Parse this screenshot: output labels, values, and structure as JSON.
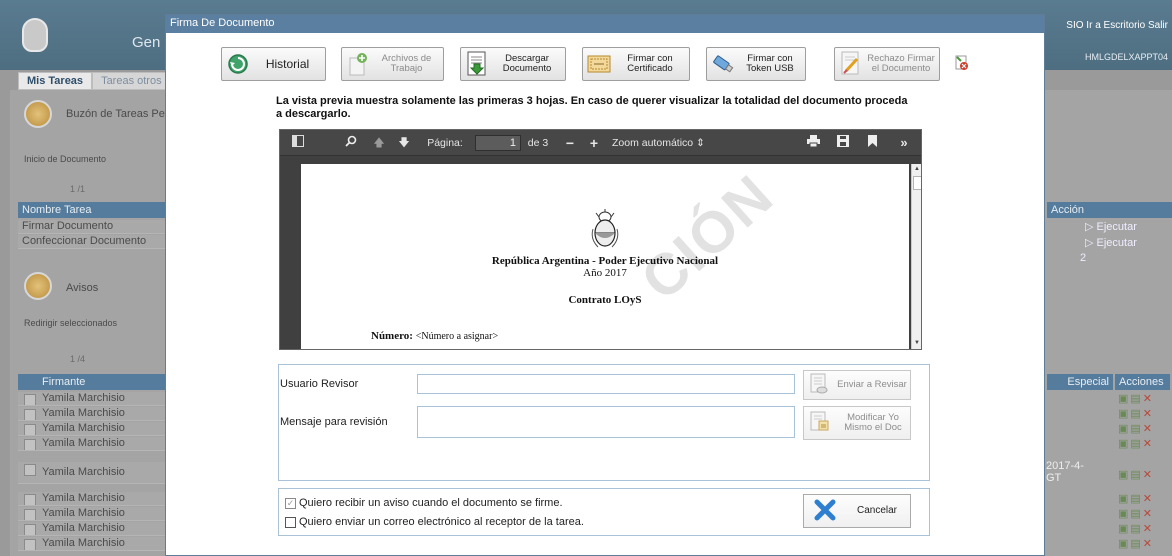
{
  "background": {
    "app_title": "Gen",
    "top_links": "SIO  Ir a Escritorio  Salir",
    "server": "HMLGDELXAPPT04",
    "tabs": [
      "Mis Tareas",
      "Tareas otros"
    ],
    "bandeja": "Buzón de Tareas Pe",
    "inicio": "Inicio de Documento",
    "pager1": "1",
    "pager1_total": "/1",
    "tasks_header": "Nombre Tarea",
    "tasks": [
      "Firmar Documento",
      "Confeccionar Documento"
    ],
    "accion_header": "Acción",
    "ejecutar": [
      "Ejecutar",
      "Ejecutar"
    ],
    "count": "2",
    "avisos": "Avisos",
    "redirigir": "Redirigir seleccionados",
    "pager2": "1",
    "pager2_total": "/4",
    "firmante_header": "Firmante",
    "firmantes": [
      "Yamila Marchisio",
      "Yamila Marchisio",
      "Yamila Marchisio",
      "Yamila Marchisio",
      "Yamila Marchisio",
      "Yamila Marchisio",
      "Yamila Marchisio",
      "Yamila Marchisio",
      "Yamila Marchisio"
    ],
    "especial_header": "Especial",
    "acciones_header": "Acciones",
    "fecha_frag": "2017-4-",
    "fecha_frag2": "GT"
  },
  "modal": {
    "title": "Firma De Documento",
    "toolbar": {
      "historial": "Historial",
      "archivos": "Archivos de Trabajo",
      "descargar": "Descargar Documento",
      "firmar_cert": "Firmar con Certificado",
      "firmar_usb": "Firmar con Token USB",
      "rechazo": "Rechazo Firmar el Documento"
    },
    "notice": "La vista previa muestra solamente las primeras 3 hojas. En caso de querer visualizar la totalidad del documento proceda a descargarlo.",
    "viewer": {
      "page_label": "Página:",
      "page_current": "1",
      "page_total": "de 3",
      "zoom": "Zoom automático",
      "page": {
        "watermark": "CIÓN",
        "line1": "República Argentina - Poder Ejecutivo Nacional",
        "line2": "Año 2017",
        "line3": "Contrato LOyS",
        "numero_label": "Número:",
        "numero_value": "<Número a asignar>"
      }
    },
    "review": {
      "usuario_label": "Usuario Revisor",
      "usuario_value": "",
      "mensaje_label": "Mensaje para revisión",
      "mensaje_value": "",
      "enviar": "Enviar a Revisar",
      "modificar": "Modificar Yo Mismo el Doc"
    },
    "options": {
      "aviso": "Quiero recibir un aviso cuando el documento se firme.",
      "aviso_checked": true,
      "correo": "Quiero enviar un correo electrónico al receptor de la tarea.",
      "correo_checked": false,
      "cancelar": "Cancelar"
    }
  }
}
